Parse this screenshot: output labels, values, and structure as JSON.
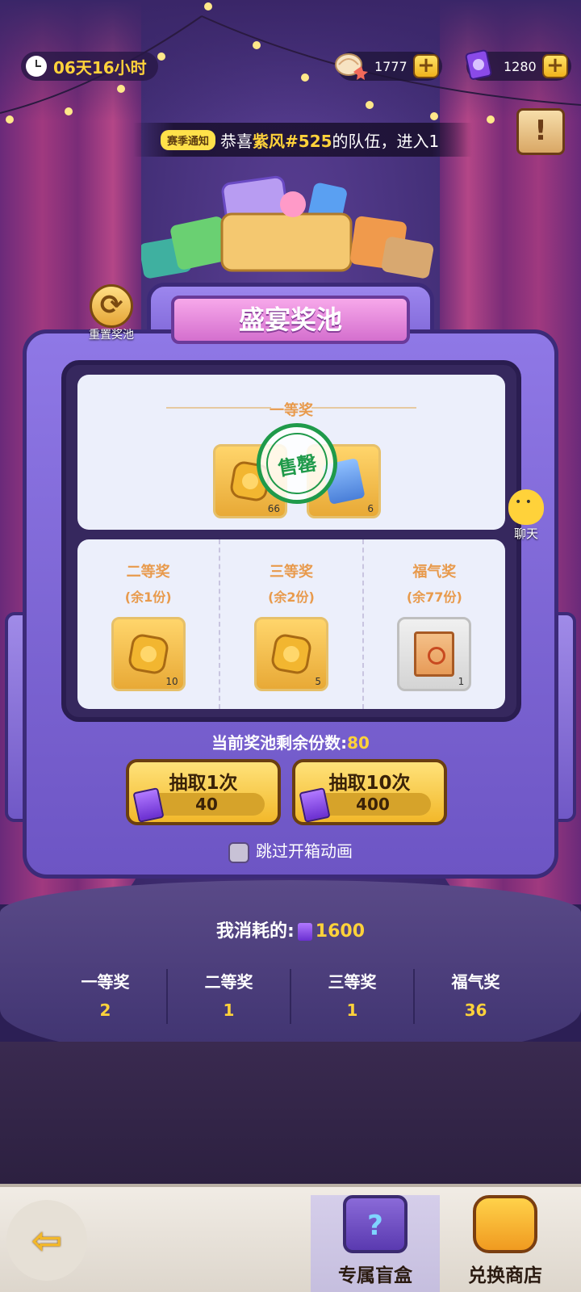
{
  "header": {
    "timer": "06天16小时",
    "currency1": {
      "icon": "shell-icon",
      "value": "1777"
    },
    "currency2": {
      "icon": "ticket-icon",
      "value": "1280"
    }
  },
  "notice": {
    "tag": "赛季通知",
    "prefix": "恭喜",
    "name": "紫风#525",
    "suffix": "的队伍，进入1"
  },
  "pool": {
    "title": "盛宴奖池",
    "reset_label": "重置奖池",
    "first": {
      "label": "一等奖",
      "items": [
        {
          "count": "66"
        },
        {
          "count": "6"
        }
      ],
      "stamp": "售罄"
    },
    "prizes": [
      {
        "label": "二等奖",
        "remaining": "(余1份)",
        "count": "10"
      },
      {
        "label": "三等奖",
        "remaining": "(余2份)",
        "count": "5"
      },
      {
        "label": "福气奖",
        "remaining": "(余77份)",
        "count": "1"
      }
    ],
    "remain_label": "当前奖池剩余份数:",
    "remain_value": "80",
    "draw1": {
      "label": "抽取1次",
      "cost": "40"
    },
    "draw10": {
      "label": "抽取10次",
      "cost": "400"
    },
    "skip_label": "跳过开箱动画"
  },
  "chat_label": "聊天",
  "consumed": {
    "label": "我消耗的:",
    "value": "1600"
  },
  "stats": [
    {
      "label": "一等奖",
      "value": "2"
    },
    {
      "label": "二等奖",
      "value": "1"
    },
    {
      "label": "三等奖",
      "value": "1"
    },
    {
      "label": "福气奖",
      "value": "36"
    }
  ],
  "bottom": {
    "tab1": "专属盲盒",
    "tab2": "兑换商店"
  },
  "colors": {
    "accent": "#ffd23a",
    "prize_label": "#e89a4c",
    "frame": "#7b62d4"
  }
}
